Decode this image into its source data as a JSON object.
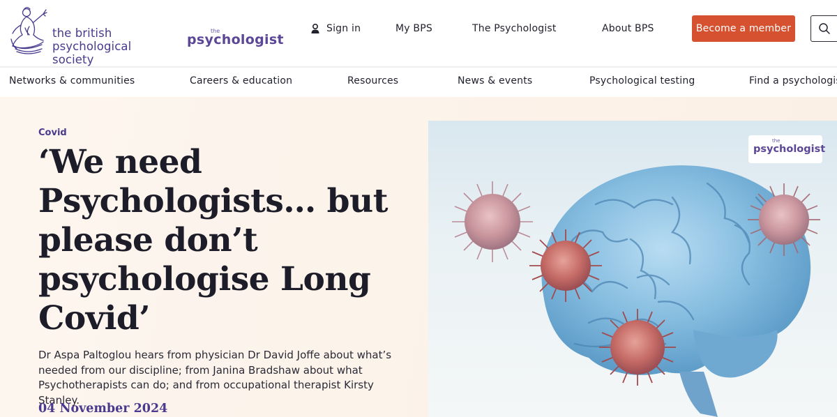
{
  "header": {
    "org_name_line1": "the british",
    "org_name_line2": "psychological society",
    "publication_logo": {
      "the": "the",
      "word": "psychologist"
    },
    "nav": {
      "sign_in": "Sign in",
      "my_bps": "My BPS",
      "the_psychologist": "The Psychologist",
      "about_bps": "About BPS"
    },
    "become_member": "Become a member"
  },
  "subnav": {
    "items": [
      "Networks & communities",
      "Careers & education",
      "Resources",
      "News & events",
      "Psychological testing",
      "Find a psychologist"
    ]
  },
  "article": {
    "category": "Covid",
    "title": "‘We need Psychologists… but please don’t psychologise Long Covid’",
    "standfirst": "Dr Aspa Paltoglou hears from physician Dr David Joffe about what’s needed from our discipline; from Janina Bradshaw about what Psychotherapists can do; and from occupational therapist Kirsty Stanley.",
    "date": "04 November 2024"
  },
  "image": {
    "badge": {
      "the": "the",
      "word": "psychologist"
    }
  },
  "colors": {
    "brand_purple": "#4a3a8e",
    "cta_orange": "#d5512f",
    "brain_blue": "#7fb4d8",
    "virus_red": "#c46a6a"
  },
  "icons": [
    "user-icon",
    "search-icon",
    "bps-figure-logo",
    "brain-illustration",
    "virus-illustration"
  ]
}
